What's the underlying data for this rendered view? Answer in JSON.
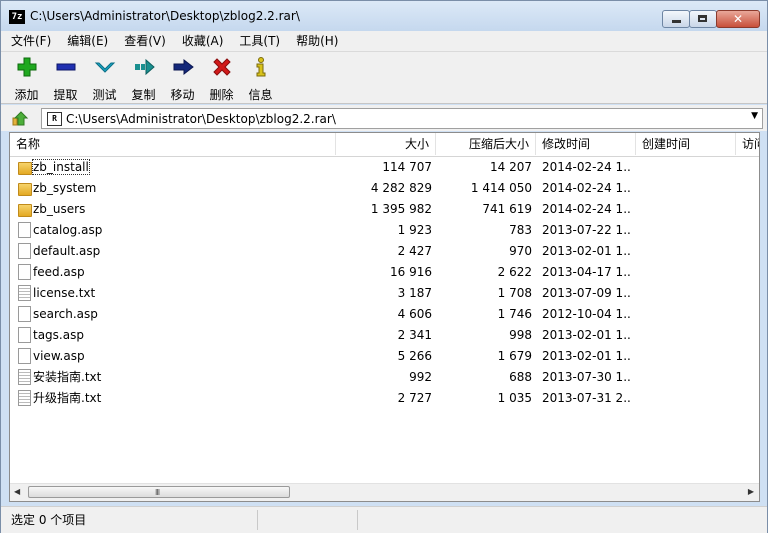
{
  "window": {
    "title": "C:\\Users\\Administrator\\Desktop\\zblog2.2.rar\\",
    "app_icon_text": "7z",
    "close_glyph": "✕"
  },
  "menu": [
    "文件(F)",
    "编辑(E)",
    "查看(V)",
    "收藏(A)",
    "工具(T)",
    "帮助(H)"
  ],
  "toolbar": [
    {
      "label": "添加",
      "icon": "add-icon",
      "color": "#1fa81f"
    },
    {
      "label": "提取",
      "icon": "extract-icon",
      "color": "#1f2fb0"
    },
    {
      "label": "测试",
      "icon": "test-icon",
      "color": "#1aa6c4"
    },
    {
      "label": "复制",
      "icon": "copy-icon",
      "color": "#1a8f8f"
    },
    {
      "label": "移动",
      "icon": "move-icon",
      "color": "#14287a"
    },
    {
      "label": "删除",
      "icon": "delete-icon",
      "color": "#d11a1a"
    },
    {
      "label": "信息",
      "icon": "info-icon",
      "color": "#d8c21a"
    }
  ],
  "address": {
    "path": "C:\\Users\\Administrator\\Desktop\\zblog2.2.rar\\",
    "icon_text": "R"
  },
  "columns": {
    "name": "名称",
    "size": "大小",
    "packed": "压缩后大小",
    "modified": "修改时间",
    "created": "创建时间",
    "accessed": "访问"
  },
  "files": [
    {
      "name": "zb_install",
      "type": "folder",
      "size": "114 707",
      "packed": "14 207",
      "modified": "2014-02-24 1..."
    },
    {
      "name": "zb_system",
      "type": "folder",
      "size": "4 282 829",
      "packed": "1 414 050",
      "modified": "2014-02-24 1..."
    },
    {
      "name": "zb_users",
      "type": "folder",
      "size": "1 395 982",
      "packed": "741 619",
      "modified": "2014-02-24 1..."
    },
    {
      "name": "catalog.asp",
      "type": "file",
      "size": "1 923",
      "packed": "783",
      "modified": "2013-07-22 1..."
    },
    {
      "name": "default.asp",
      "type": "file",
      "size": "2 427",
      "packed": "970",
      "modified": "2013-02-01 1..."
    },
    {
      "name": "feed.asp",
      "type": "file",
      "size": "16 916",
      "packed": "2 622",
      "modified": "2013-04-17 1..."
    },
    {
      "name": "license.txt",
      "type": "text",
      "size": "3 187",
      "packed": "1 708",
      "modified": "2013-07-09 1..."
    },
    {
      "name": "search.asp",
      "type": "file",
      "size": "4 606",
      "packed": "1 746",
      "modified": "2012-10-04 1..."
    },
    {
      "name": "tags.asp",
      "type": "file",
      "size": "2 341",
      "packed": "998",
      "modified": "2013-02-01 1..."
    },
    {
      "name": "view.asp",
      "type": "file",
      "size": "5 266",
      "packed": "1 679",
      "modified": "2013-02-01 1..."
    },
    {
      "name": "安装指南.txt",
      "type": "text",
      "size": "992",
      "packed": "688",
      "modified": "2013-07-30 1..."
    },
    {
      "name": "升级指南.txt",
      "type": "text",
      "size": "2 727",
      "packed": "1 035",
      "modified": "2013-07-31 2..."
    }
  ],
  "scrollbar": {
    "grip": "III",
    "left_arrow": "◀",
    "right_arrow": "▶"
  },
  "status": {
    "text": "选定 0 个项目"
  }
}
